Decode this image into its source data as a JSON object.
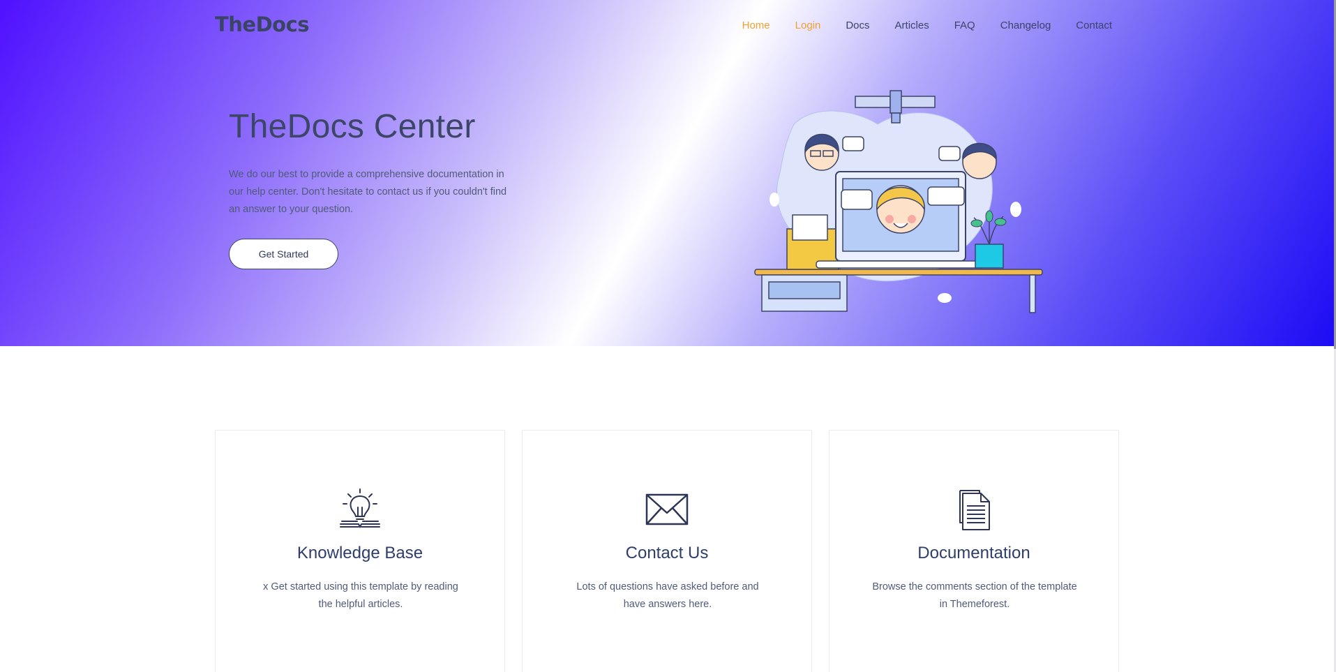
{
  "brand": {
    "logo": "TheDocs"
  },
  "nav": {
    "items": [
      {
        "label": "Home",
        "active": true
      },
      {
        "label": "Login",
        "active": true
      },
      {
        "label": "Docs",
        "active": false
      },
      {
        "label": "Articles",
        "active": false
      },
      {
        "label": "FAQ",
        "active": false
      },
      {
        "label": "Changelog",
        "active": false
      },
      {
        "label": "Contact",
        "active": false
      }
    ]
  },
  "hero": {
    "title": "TheDocs Center",
    "description": "We do our best to provide a comprehensive documentation in our help center. Don't hesitate to contact us if you couldn't find an answer to your question.",
    "cta_label": "Get Started",
    "illustration_icon": "support-desk-illustration"
  },
  "cards": [
    {
      "icon": "lightbulb-book-icon",
      "title": "Knowledge Base",
      "description": "x Get started using this template by reading the helpful articles."
    },
    {
      "icon": "envelope-icon",
      "title": "Contact Us",
      "description": "Lots of questions have asked before and have answers here."
    },
    {
      "icon": "document-icon",
      "title": "Documentation",
      "description": "Browse the comments section of the template in Themeforest."
    }
  ],
  "colors": {
    "accent": "#f3a02e",
    "heading": "#2e3e6b",
    "text": "#505a7a",
    "gradient_start": "#4f10ff",
    "gradient_end": "#1d0bf5"
  }
}
